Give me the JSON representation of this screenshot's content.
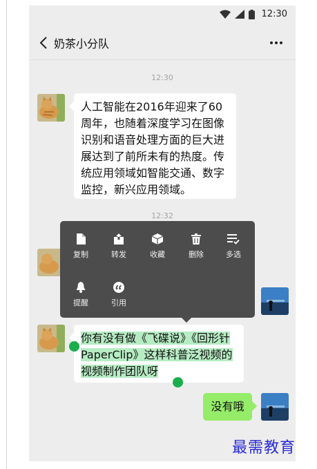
{
  "status": {
    "time": "12:30",
    "icons": [
      "wifi-icon",
      "cell-signal-icon",
      "battery-icon"
    ]
  },
  "header": {
    "title": "奶茶小分队",
    "back_icon": "chevron-left-icon",
    "more_icon": "more-dots-icon"
  },
  "timestamps": [
    "12:30",
    "12:32"
  ],
  "messages": [
    {
      "side": "left",
      "text": "人工智能在2016年迎来了60周年，也随着深度学习在图像识别和语音处理方面的巨大进展达到了前所未有的热度。传统应用领域如智能交通、数字监控，新兴应用领域。"
    },
    {
      "side": "left",
      "text": "你有没有做《飞碟说》《回形针PaperClip》这样科普泛视频的视频制作团队呀",
      "selected": true
    },
    {
      "side": "right",
      "text": "没有哦"
    }
  ],
  "context_menu": {
    "items": [
      {
        "label": "复制",
        "icon": "copy-icon"
      },
      {
        "label": "转发",
        "icon": "forward-icon"
      },
      {
        "label": "收藏",
        "icon": "favorite-box-icon"
      },
      {
        "label": "删除",
        "icon": "trash-icon"
      },
      {
        "label": "多选",
        "icon": "multi-select-icon"
      },
      {
        "label": "提醒",
        "icon": "bell-icon"
      },
      {
        "label": "引用",
        "icon": "quote-icon"
      }
    ]
  },
  "colors": {
    "chat_bg": "#ededed",
    "my_bubble": "#95ec69",
    "selection": "#b6ecc3",
    "handle": "#1aad4b",
    "menu_bg": "#4c4c4c"
  },
  "watermark": "最需教育"
}
